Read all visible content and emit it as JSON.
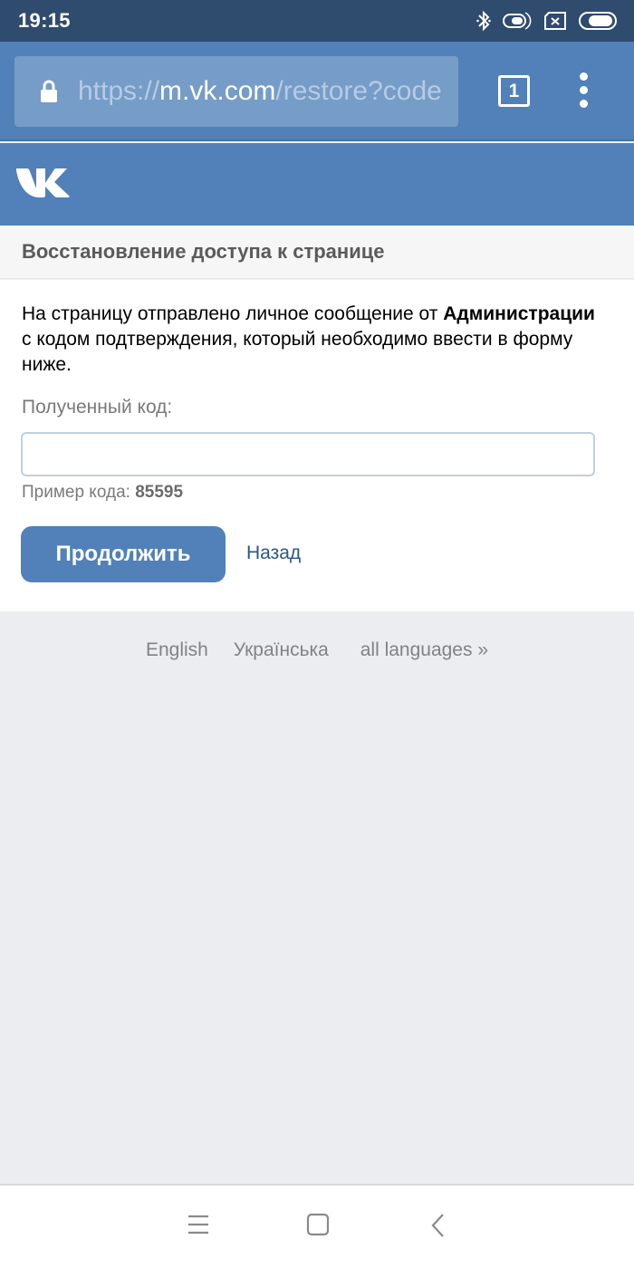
{
  "status_bar": {
    "time": "19:15",
    "icons": [
      "bluetooth-icon",
      "toggle-icon",
      "sim-card-no-signal-icon",
      "battery-icon"
    ]
  },
  "browser": {
    "url_prefix": "https://",
    "url_domain": "m.vk.com",
    "url_path": "/restore?code",
    "tab_count": "1",
    "icons": [
      "lock-icon",
      "tabs-icon",
      "more-vert-icon"
    ]
  },
  "header": {
    "logo": "VK"
  },
  "page": {
    "title": "Восстановление доступа к странице",
    "message_part1": "На страницу отправлено личное сообщение от ",
    "message_bold": "Администрации",
    "message_part2": " с кодом подтверждения, который необходимо ввести в форму ниже.",
    "code_label": "Полученный код:",
    "code_value": "",
    "code_placeholder": "",
    "example_label": "Пример кода: ",
    "example_code": "85595",
    "continue_label": "Продолжить",
    "back_label": "Назад"
  },
  "footer": {
    "languages": [
      "English",
      "Українська",
      "all languages »"
    ]
  },
  "nav_bar": {
    "icons": [
      "menu-icon",
      "home-icon",
      "back-icon"
    ]
  },
  "colors": {
    "vk_blue": "#5181b8",
    "status_bar": "#2f4b6e",
    "link": "#2a5885",
    "background": "#ebedf0"
  }
}
